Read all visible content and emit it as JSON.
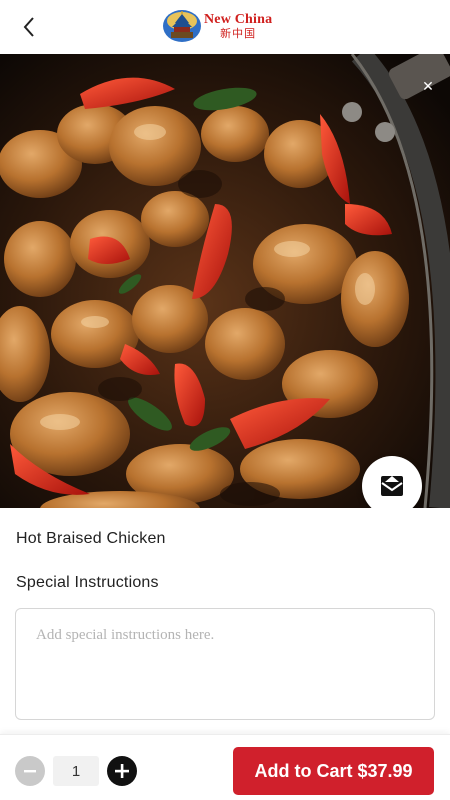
{
  "header": {
    "back_icon": "chevron-left-icon",
    "logo": {
      "name_en": "New China",
      "name_zh": "新中国",
      "emblem_icon": "temple-of-heaven-icon"
    }
  },
  "hero": {
    "image": "braised chicken with red peppers in a wok",
    "close_icon": "close-icon",
    "share_icon": "envelope-share-icon"
  },
  "item": {
    "name": "Hot Braised Chicken"
  },
  "instructions": {
    "label": "Special Instructions",
    "placeholder": "Add special instructions here.",
    "value": ""
  },
  "cart": {
    "minus_icon": "minus-icon",
    "quantity": "1",
    "plus_icon": "plus-icon",
    "add_label": "Add to Cart $37.99"
  },
  "colors": {
    "brand_red": "#d0202c",
    "logo_red": "#d0201e",
    "minus_disabled": "#c9c9c9",
    "plus_dark": "#111111"
  }
}
